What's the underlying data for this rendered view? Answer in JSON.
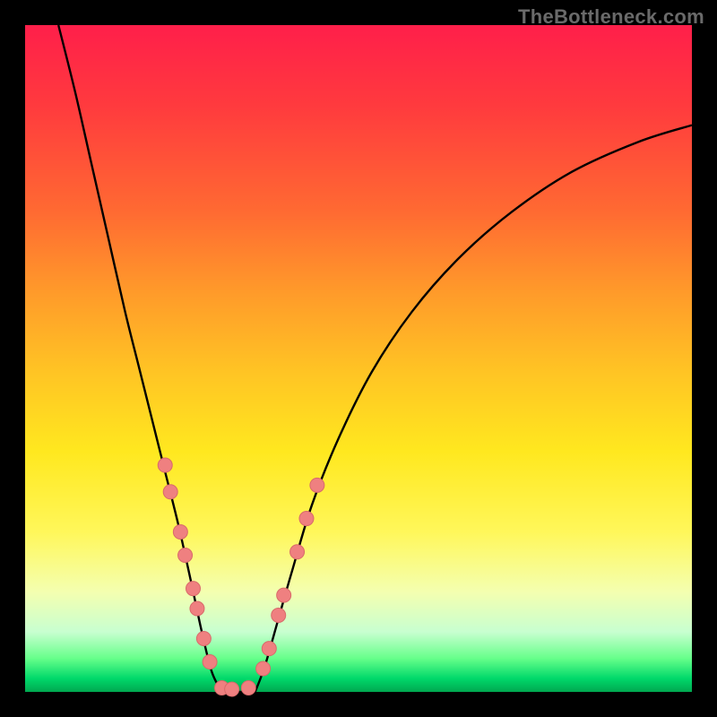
{
  "watermark": "TheBottleneck.com",
  "chart_data": {
    "type": "line",
    "title": "",
    "xlabel": "",
    "ylabel": "",
    "xlim": [
      0,
      100
    ],
    "ylim": [
      0,
      100
    ],
    "series": [
      {
        "name": "left-branch",
        "x": [
          5,
          7.5,
          10,
          12.5,
          15,
          17,
          19,
          21,
          23,
          25,
          26.5,
          28,
          29.5
        ],
        "y": [
          100,
          90,
          79,
          68,
          57,
          49,
          41,
          33,
          25,
          16,
          9,
          3,
          0
        ]
      },
      {
        "name": "valley-floor",
        "x": [
          29.5,
          32,
          34.5
        ],
        "y": [
          0,
          0,
          0
        ]
      },
      {
        "name": "right-branch",
        "x": [
          34.5,
          36,
          38,
          40,
          43,
          47,
          52,
          58,
          65,
          73,
          82,
          92,
          100
        ],
        "y": [
          0,
          4,
          11,
          18,
          28,
          38,
          48,
          57,
          65,
          72,
          78,
          82.5,
          85
        ]
      }
    ],
    "dots": {
      "name": "marker-points",
      "points": [
        {
          "x": 21.0,
          "y": 34
        },
        {
          "x": 21.8,
          "y": 30
        },
        {
          "x": 23.3,
          "y": 24
        },
        {
          "x": 24.0,
          "y": 20.5
        },
        {
          "x": 25.2,
          "y": 15.5
        },
        {
          "x": 25.8,
          "y": 12.5
        },
        {
          "x": 26.8,
          "y": 8
        },
        {
          "x": 27.7,
          "y": 4.5
        },
        {
          "x": 29.5,
          "y": 0.6
        },
        {
          "x": 31.0,
          "y": 0.4
        },
        {
          "x": 33.5,
          "y": 0.6
        },
        {
          "x": 35.7,
          "y": 3.5
        },
        {
          "x": 36.6,
          "y": 6.5
        },
        {
          "x": 38.0,
          "y": 11.5
        },
        {
          "x": 38.8,
          "y": 14.5
        },
        {
          "x": 40.8,
          "y": 21
        },
        {
          "x": 42.2,
          "y": 26
        },
        {
          "x": 43.8,
          "y": 31
        }
      ]
    },
    "colors": {
      "top": "#ff1f4a",
      "bottom": "#00a850",
      "curve": "#000000",
      "dot": "#ef8080"
    }
  }
}
